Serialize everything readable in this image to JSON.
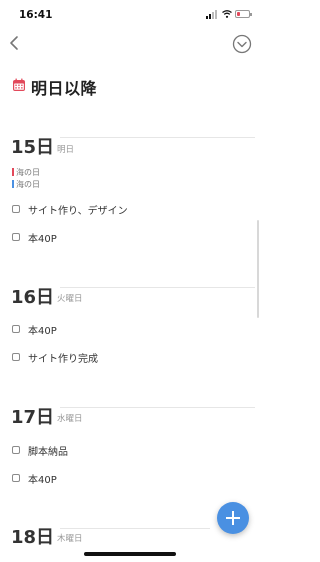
{
  "status": {
    "time": "16:41"
  },
  "page": {
    "title": "明日以降"
  },
  "days": [
    {
      "date": "15日",
      "sub": "明日",
      "holidays": [
        {
          "label": "海の日",
          "color": "#e2495b"
        },
        {
          "label": "海の日",
          "color": "#4a90e2"
        }
      ],
      "tasks": [
        "サイト作り、デザイン",
        "本40P"
      ]
    },
    {
      "date": "16日",
      "sub": "火曜日",
      "tasks": [
        "本40P",
        "サイト作り完成"
      ]
    },
    {
      "date": "17日",
      "sub": "水曜日",
      "tasks": [
        "脚本納品",
        "本40P"
      ]
    },
    {
      "date": "18日",
      "sub": "木曜日",
      "tasks": []
    }
  ],
  "colors": {
    "accent": "#4a90e2",
    "calendar_icon": "#e2495b"
  },
  "icons": {
    "back": "chevron-left-icon",
    "more": "chevron-down-circle-icon",
    "add": "plus-icon",
    "calendar": "calendar-icon"
  }
}
